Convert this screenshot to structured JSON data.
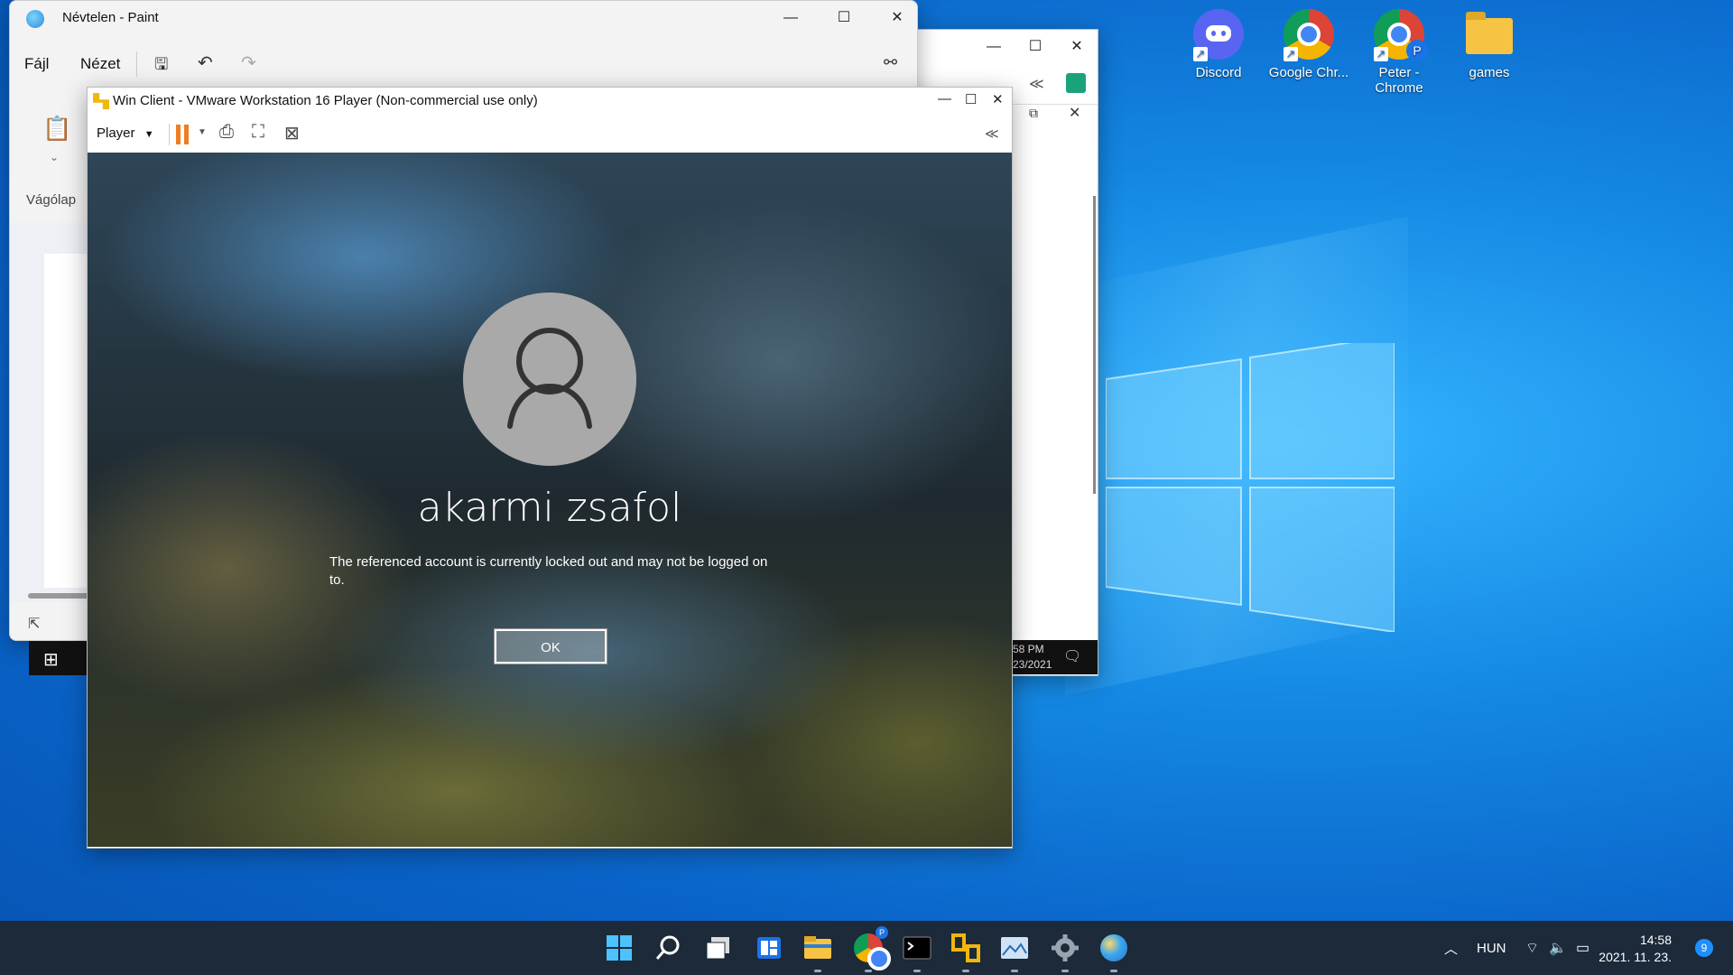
{
  "desktop": {
    "icons": [
      {
        "label": "Discord"
      },
      {
        "label": "Google Chr..."
      },
      {
        "label": "Peter -\nChrome"
      },
      {
        "label": "games"
      }
    ]
  },
  "paint": {
    "title": "Névtelen - Paint",
    "menu": {
      "file": "Fájl",
      "view": "Nézet"
    },
    "clipboard_label": "Vágólap"
  },
  "bgwin": {
    "time": "58 PM",
    "date": "23/2021"
  },
  "vmware": {
    "title": "Win Client - VMware Workstation 16 Player (Non-commercial use only)",
    "player_menu": "Player",
    "login": {
      "username": "akarmi zsafol",
      "message": "The referenced account is currently locked out and may not be logged on to.",
      "ok_label": "OK"
    }
  },
  "taskbar": {
    "language": "HUN",
    "time": "14:58",
    "date": "2021. 11. 23.",
    "notification_count": "9"
  },
  "colors": {
    "accent": "#1f8fff",
    "taskbar": "#1c2a3a",
    "pause_orange": "#f07d22"
  }
}
